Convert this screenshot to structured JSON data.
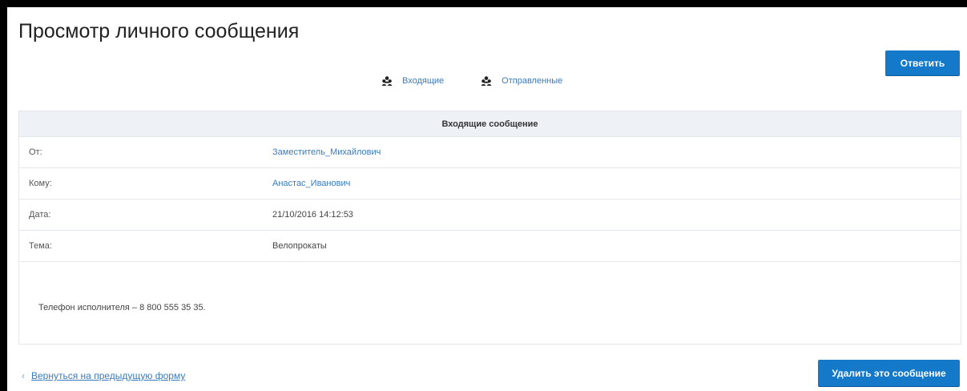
{
  "page": {
    "title": "Просмотр личного сообщения"
  },
  "actions": {
    "reply_label": "Ответить",
    "delete_label": "Удалить это сообщение"
  },
  "nav": {
    "items": [
      {
        "label": "Входящие",
        "icon": "users-icon"
      },
      {
        "label": "Отправленные",
        "icon": "users-icon"
      }
    ]
  },
  "message": {
    "header": "Входящие сообщение",
    "fields": [
      {
        "label": "От:",
        "value": "Заместитель_Михайлович",
        "is_link": true
      },
      {
        "label": "Кому:",
        "value": "Анастас_Иванович",
        "is_link": true
      },
      {
        "label": "Дата:",
        "value": "21/10/2016 14:12:53",
        "is_link": false
      },
      {
        "label": "Тема:",
        "value": "Велопрокаты",
        "is_link": false
      }
    ],
    "body": "Телефон исполнителя – 8 800 555 35 35."
  },
  "footer": {
    "back_label": "Вернуться на предыдущую форму"
  },
  "colors": {
    "accent": "#1479c9",
    "link": "#3a7bbf",
    "header_bg": "#eef2f7",
    "border": "#e3e6ea"
  }
}
